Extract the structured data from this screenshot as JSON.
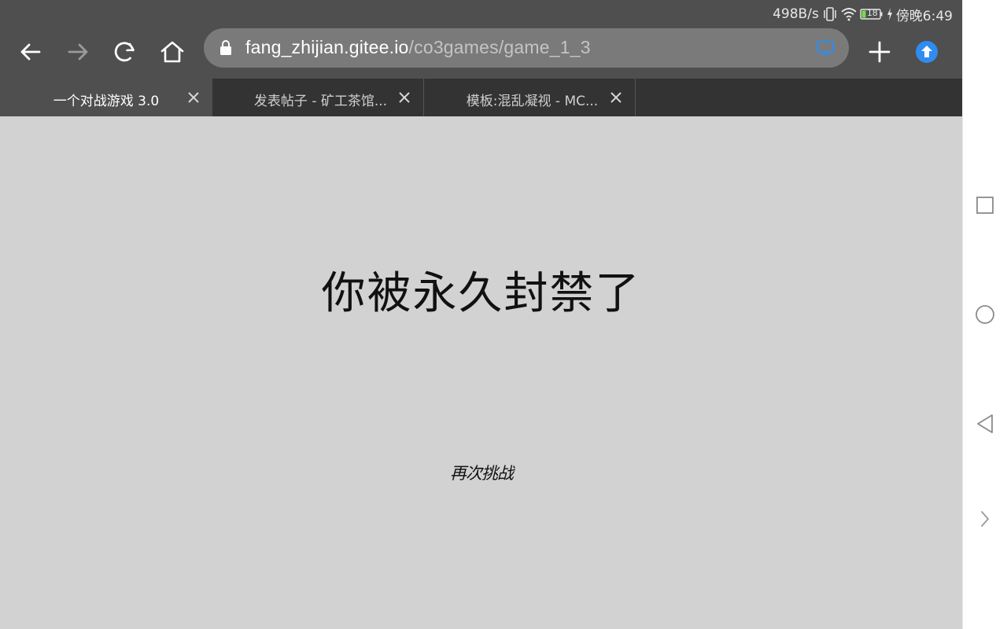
{
  "status_bar": {
    "speed": "498B/s",
    "battery": "18",
    "time": "傍晚6:49"
  },
  "toolbar": {
    "url_host": "fang_zhijian.gitee.io",
    "url_path": "/co3games/game_1_3"
  },
  "tabs": [
    {
      "title": "一个对战游戏 3.0",
      "active": true
    },
    {
      "title": "发表帖子 - 矿工茶馆...",
      "active": false
    },
    {
      "title": "模板:混乱凝视 - MC...",
      "active": false
    }
  ],
  "page": {
    "ban_message": "你被永久封禁了",
    "retry_label": "再次挑战"
  },
  "colors": {
    "toolbar_bg": "#4f4f4f",
    "tabstrip_bg": "#333333",
    "content_bg": "#d2d2d2",
    "accent_blue": "#2f8cf0"
  }
}
